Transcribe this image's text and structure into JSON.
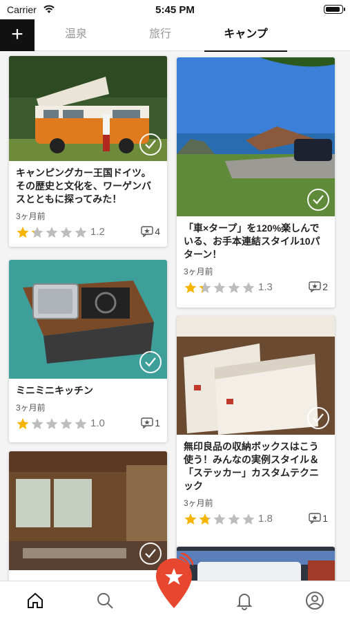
{
  "status_bar": {
    "carrier": "Carrier",
    "time": "5:45 PM"
  },
  "tabs": [
    {
      "label": "温泉",
      "active": false
    },
    {
      "label": "旅行",
      "active": false
    },
    {
      "label": "キャンプ",
      "active": true
    }
  ],
  "add_button": "+",
  "cards": [
    {
      "title": "キャンピングカー王国ドイツ。その歴史と文化を、ワーゲンバスとともに探ってみた！",
      "age": "3ヶ月前",
      "rating": 1.2,
      "rating_text": "1.2",
      "reviews": "4"
    },
    {
      "title": "「車×タープ」を120%楽しんでいる、お手本連結スタイル10パターン！",
      "age": "3ヶ月前",
      "rating": 1.3,
      "rating_text": "1.3",
      "reviews": "2"
    },
    {
      "title": "ミニミニキッチン",
      "age": "3ヶ月前",
      "rating": 1.0,
      "rating_text": "1.0",
      "reviews": "1"
    },
    {
      "title": "無印良品の収納ボックスはこう使う！みんなの実例スタイル＆「ステッカー」カスタムテクニック",
      "age": "3ヶ月前",
      "rating": 1.8,
      "rating_text": "1.8",
      "reviews": "1"
    }
  ],
  "colors": {
    "star_active": "#f5b400",
    "star_inactive": "#bdbdbd",
    "fab": "#e8472f",
    "fab_signal": "#e8472f"
  },
  "bottom_nav": [
    "home-icon",
    "search-icon",
    "star-pin-icon",
    "bell-icon",
    "profile-icon"
  ]
}
